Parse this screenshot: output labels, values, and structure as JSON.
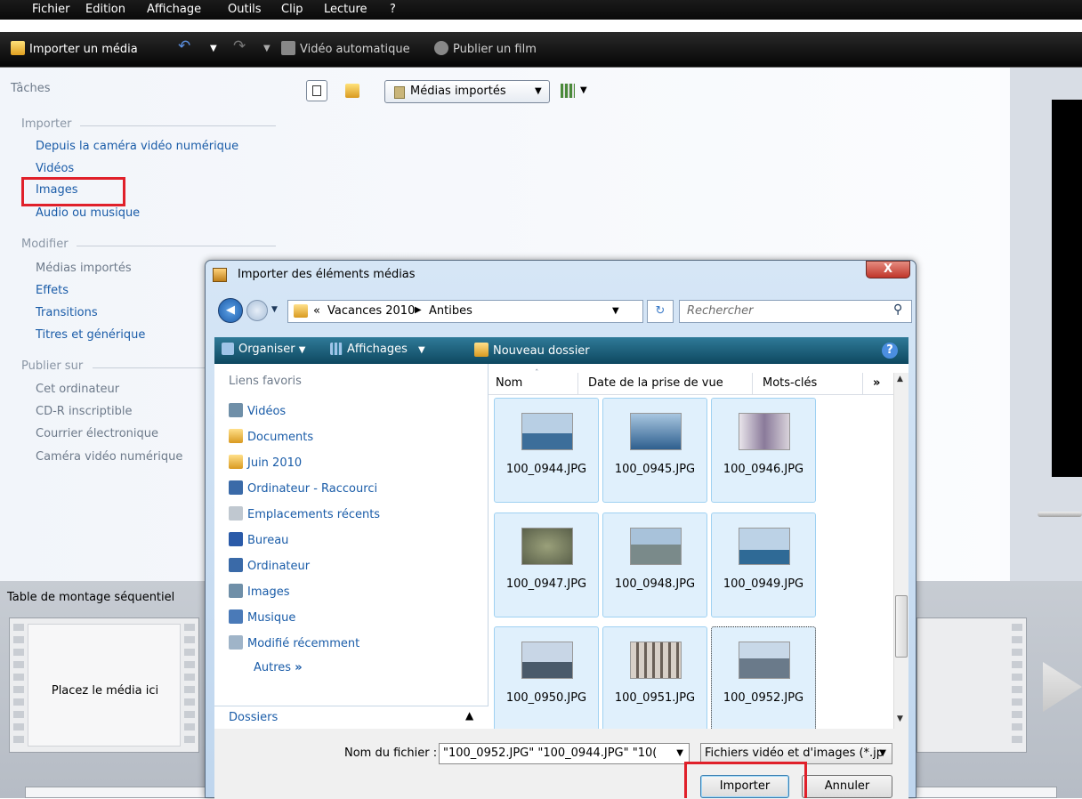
{
  "menubar": {
    "items": [
      "Fichier",
      "Edition",
      "Affichage",
      "Outils",
      "Clip",
      "Lecture",
      "?"
    ]
  },
  "toolbar": {
    "import": "Importer un média",
    "auto_video": "Vidéo automatique",
    "publish": "Publier un film"
  },
  "tasks": {
    "title": "Tâches",
    "import_header": "Importer",
    "import_items": [
      "Depuis la caméra vidéo numérique",
      "Vidéos",
      "Images",
      "Audio ou musique"
    ],
    "modify_header": "Modifier",
    "modify_items": [
      "Médias importés",
      "Effets",
      "Transitions",
      "Titres et générique"
    ],
    "publish_header": "Publier sur",
    "publish_items": [
      "Cet ordinateur",
      "CD-R inscriptible",
      "Courrier électronique",
      "Caméra vidéo numérique"
    ]
  },
  "collection": {
    "selected": "Médias importés"
  },
  "storyboard": {
    "title": "Table de montage séquentiel",
    "drop_hint": "Placez le média ici"
  },
  "dialog": {
    "title": "Importer des éléments médias",
    "close": "X",
    "path": [
      "Vacances 2010",
      "Antibes"
    ],
    "path_prefix": "«",
    "search_placeholder": "Rechercher",
    "cmd": {
      "organize": "Organiser",
      "views": "Affichages",
      "new_folder": "Nouveau dossier",
      "help": "?"
    },
    "favorites_title": "Liens favoris",
    "favorites": [
      "Vidéos",
      "Documents",
      "Juin 2010",
      "Ordinateur - Raccourci",
      "Emplacements récents",
      "Bureau",
      "Ordinateur",
      "Images",
      "Musique",
      "Modifié récemment"
    ],
    "more": "Autres",
    "more_glyph": "»",
    "folders": "Dossiers",
    "columns": [
      "Nom",
      "Date de la prise de vue",
      "Mots-clés"
    ],
    "col_more": "»",
    "files": [
      "100_0944.JPG",
      "100_0945.JPG",
      "100_0946.JPG",
      "100_0947.JPG",
      "100_0948.JPG",
      "100_0949.JPG",
      "100_0950.JPG",
      "100_0951.JPG",
      "100_0952.JPG"
    ],
    "filename_label": "Nom du fichier :",
    "filename_value": "\"100_0952.JPG\" \"100_0944.JPG\" \"10(",
    "filetype_value": "Fichiers vidéo et d'images (*.jp",
    "import_btn": "Importer",
    "cancel_btn": "Annuler"
  },
  "colors": {
    "highlight": "#e0202a",
    "link": "#1a5ca8"
  }
}
